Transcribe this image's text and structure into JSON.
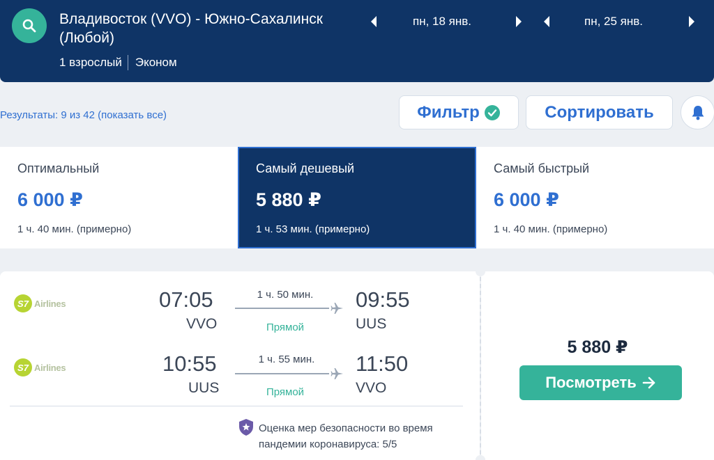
{
  "header": {
    "route": "Владивосток (VVO) - Южно-Сахалинск (Любой)",
    "passengers": "1 взрослый",
    "cabin_class": "Эконом",
    "depart_date": "пн, 18 янв.",
    "return_date": "пн, 25 янв.",
    "icons": {
      "search": "search-icon",
      "prev": "caret-left-icon",
      "next": "caret-right-icon"
    }
  },
  "toolbar": {
    "results_text": "Результаты: 9 из 42 (показать все)",
    "filter_label": "Фильтр",
    "sort_label": "Сортировать",
    "icons": {
      "filter_check": "check-circle-icon",
      "alert": "bell-icon"
    }
  },
  "tabs": [
    {
      "label": "Оптимальный",
      "price": "6 000 ₽",
      "duration": "1 ч. 40 мин. (примерно)",
      "active": false
    },
    {
      "label": "Самый дешевый",
      "price": "5 880 ₽",
      "duration": "1 ч. 53 мин. (примерно)",
      "active": true
    },
    {
      "label": "Самый быстрый",
      "price": "6 000 ₽",
      "duration": "1 ч. 40 мин. (примерно)",
      "active": false
    }
  ],
  "ticket": {
    "legs": [
      {
        "airline": "Airlines",
        "airline_logo_text": "S7",
        "depart_time": "07:05",
        "depart_code": "VVO",
        "duration": "1 ч. 50 мин.",
        "stops": "Прямой",
        "arrive_time": "09:55",
        "arrive_code": "UUS"
      },
      {
        "airline": "Airlines",
        "airline_logo_text": "S7",
        "depart_time": "10:55",
        "depart_code": "UUS",
        "duration": "1 ч. 55 мин.",
        "stops": "Прямой",
        "arrive_time": "11:50",
        "arrive_code": "VVO"
      }
    ],
    "safety_text": "Оценка мер безопасности во время пандемии коронавируса: 5/5",
    "price": "5 880 ₽",
    "view_label": "Посмотреть",
    "icons": {
      "plane": "plane-icon",
      "safety": "shield-icon",
      "arrow": "arrow-right-icon"
    }
  },
  "colors": {
    "header_bg": "#0f3466",
    "accent": "#35b39a",
    "link": "#2f6fd1",
    "page_bg": "#edf0f4"
  }
}
